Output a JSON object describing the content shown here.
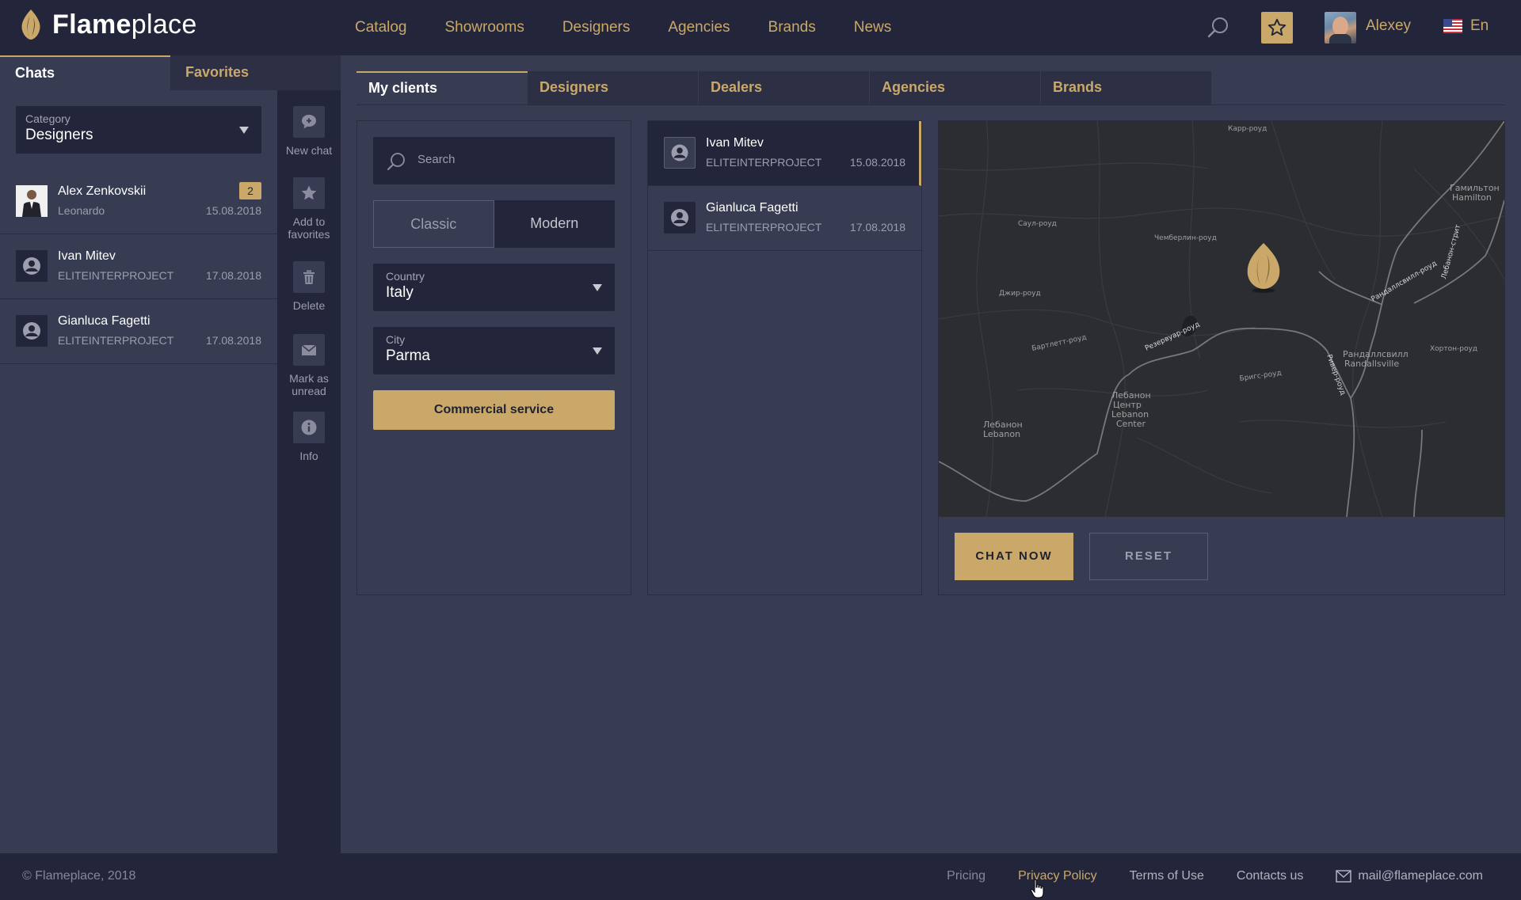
{
  "header": {
    "logo_bold": "Flame",
    "logo_light": "place",
    "nav": [
      "Catalog",
      "Showrooms",
      "Designers",
      "Agencies",
      "Brands",
      "News"
    ],
    "user_name": "Alexey",
    "language": "En",
    "icons": {
      "search": "search-icon",
      "favorites": "star-icon",
      "flag": "us-flag-icon"
    },
    "accent": "#c9a86a"
  },
  "left_tabs": [
    "Chats",
    "Favorites"
  ],
  "category": {
    "label": "Category",
    "value": "Designers"
  },
  "chats": [
    {
      "name": "Alex Zenkovskii",
      "sub": "Leonardo",
      "date": "15.08.2018",
      "badge": "2"
    },
    {
      "name": "Ivan Mitev",
      "sub": "ELITEINTERPROJECT",
      "date": "17.08.2018"
    },
    {
      "name": "Gianluca Fagetti",
      "sub": "ELITEINTERPROJECT",
      "date": "17.08.2018"
    }
  ],
  "actions": [
    {
      "label": "New chat",
      "icon": "chat-bubble-icon"
    },
    {
      "label": "Add to favorites",
      "icon": "star-icon"
    },
    {
      "label": "Delete",
      "icon": "trash-icon"
    },
    {
      "label": "Mark as unread",
      "icon": "envelope-icon"
    },
    {
      "label": "Info",
      "icon": "info-icon"
    }
  ],
  "main_tabs": [
    "My clients",
    "Designers",
    "Dealers",
    "Agencies",
    "Brands"
  ],
  "filters": {
    "search_placeholder": "Search",
    "style_options": [
      "Classic",
      "Modern"
    ],
    "country": {
      "label": "Country",
      "value": "Italy"
    },
    "city": {
      "label": "City",
      "value": "Parma"
    },
    "commercial_button": "Commercial service"
  },
  "results": [
    {
      "name": "Ivan Mitev",
      "sub": "ELITEINTERPROJECT",
      "date": "15.08.2018"
    },
    {
      "name": "Gianluca Fagetti",
      "sub": "ELITEINTERPROJECT",
      "date": "17.08.2018"
    }
  ],
  "map": {
    "labels": [
      "Гамильтон",
      "Hamilton",
      "Рандаллсвилл",
      "Randallsville",
      "Лебанон",
      "Центр",
      "Lebanon",
      "Center",
      "Лебанон",
      "Lebanon",
      "Саул-роуд",
      "Джир-роуд",
      "Бартлетт-роуд",
      "Резервуар-роуд",
      "Чемберлин-роуд",
      "Бригс-роуд",
      "Хортон-роуд",
      "Рандаллсвилл-роуд",
      "Ривер-роуд",
      "Лебанон-стрит",
      "Карр-роуд"
    ],
    "buttons": {
      "chat": "CHAT NOW",
      "reset": "RESET"
    }
  },
  "footer": {
    "copyright": "© Flameplace, 2018",
    "links": [
      "Pricing",
      "Privacy Policy",
      "Terms of Use",
      "Contacts us"
    ],
    "email": "mail@flameplace.com"
  }
}
